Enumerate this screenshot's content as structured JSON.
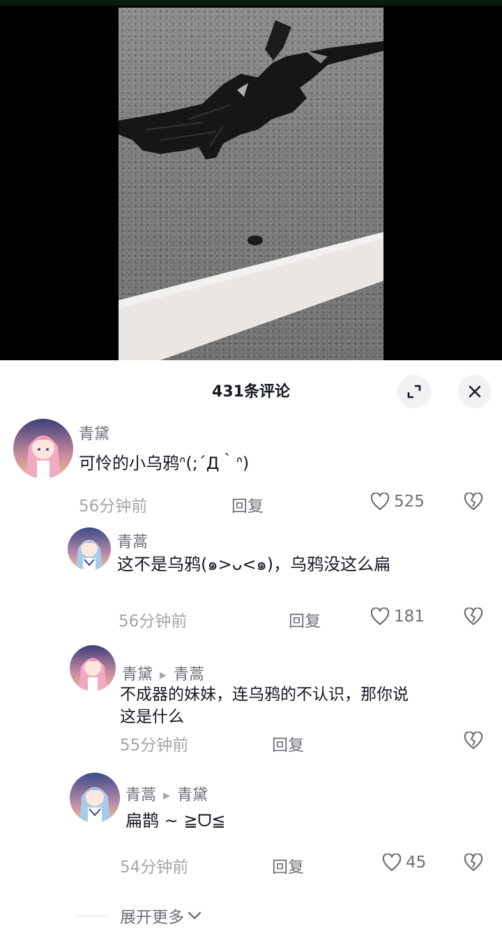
{
  "header": {
    "title": "431条评论"
  },
  "comments": [
    {
      "author": "青黛",
      "text": "可怜的小乌鸦ᐢ(;´Д｀ᐢ)",
      "time": "56分钟前",
      "reply_label": "回复",
      "likes": "525"
    },
    {
      "author": "青蒿",
      "text": "这不是乌鸦(๑>ᴗ<๑)，乌鸦没这么扁",
      "time": "56分钟前",
      "reply_label": "回复",
      "likes": "181"
    },
    {
      "author": "青黛",
      "reply_to": "青蒿",
      "text_line1": "不成器的妹妹，连乌鸦的不认识，那你说",
      "text_line2": "这是什么",
      "time": "55分钟前",
      "reply_label": "回复"
    },
    {
      "author": "青蒿",
      "reply_to": "青黛",
      "text": "扁鹊 ~ ≧ᗜ≦",
      "time": "54分钟前",
      "reply_label": "回复",
      "likes": "45"
    }
  ],
  "expand_label": "展开更多",
  "icons": {
    "expand": "expand-corner-icon",
    "close": "close-icon",
    "like": "heart-outline-icon",
    "dislike": "broken-heart-icon",
    "reply_arrow": "triangle-right-icon",
    "chevron": "chevron-down-icon"
  },
  "colors": {
    "text_primary": "#161823",
    "text_secondary": "#6d6f78",
    "text_muted": "#a5a6ab",
    "button_bg": "#f2f2f4"
  }
}
